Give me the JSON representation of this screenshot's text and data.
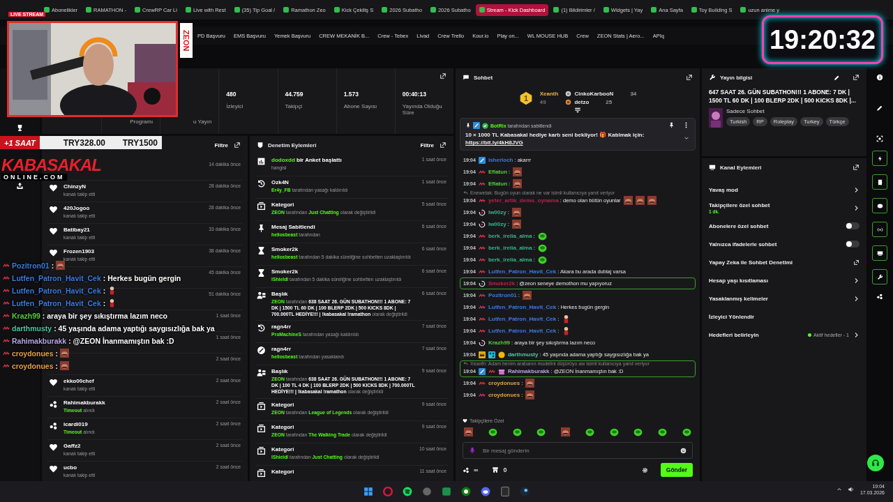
{
  "browser": {
    "tabs": [
      {
        "label": "Abonelikler",
        "selected": false
      },
      {
        "label": "RAMATHON -",
        "selected": false
      },
      {
        "label": "CrewRP Car Li",
        "selected": false
      },
      {
        "label": "Live with Rest",
        "selected": false
      },
      {
        "label": "(35) Tip Goal /",
        "selected": false
      },
      {
        "label": "Ramathon Zeo",
        "selected": false
      },
      {
        "label": "Kick Çekiliş S",
        "selected": false
      },
      {
        "label": "2026 Subatho",
        "selected": false
      },
      {
        "label": "2026 Subatho",
        "selected": false
      },
      {
        "label": "Stream - Kick Dashboard",
        "selected": true
      },
      {
        "label": "(1) Bildirimler /",
        "selected": false
      },
      {
        "label": "Widgets | Yay",
        "selected": false
      },
      {
        "label": "Ana Sayfa",
        "selected": false
      },
      {
        "label": "Toy Building S",
        "selected": false
      },
      {
        "label": "uzun anime y",
        "selected": false
      }
    ],
    "bookmarks": [
      "PD Başvuru",
      "EMS Başvuru",
      "Yemek Başvuru",
      "CREW MEKANİK B...",
      "Crew - Tebex",
      "Livad",
      "Crew Trello",
      "Kour.io",
      "Play on...",
      "WL MOUSE HUB",
      "Crew",
      "ZEON Stats | Aero...",
      "APIq"
    ]
  },
  "overlay": {
    "live_badge": "LIVE STREAM",
    "brand": "ZEON",
    "timer": "19:20:32",
    "goal": {
      "tag": "+1 SAAT",
      "current": "TRY328.00",
      "target": "TRY1500"
    },
    "logo": {
      "title": "KABASAKAL",
      "subtitle": "ONLINE.COM"
    },
    "chat": [
      {
        "user": "Pozitron01",
        "color": "#3d7be0",
        "text": ":",
        "emotes": [
          {
            "kind": "face"
          }
        ]
      },
      {
        "user": "Lutfen_Patron_Havit_Cek",
        "color": "#3d7be0",
        "text": ": Herkes bugün gergin"
      },
      {
        "user": "Lutfen_Patron_Havit_Cek",
        "color": "#3d7be0",
        "text": ":",
        "emotes": [
          {
            "kind": "figure"
          }
        ]
      },
      {
        "user": "Lutfen_Patron_Havit_Cek",
        "color": "#3d7be0",
        "text": ":",
        "emotes": [
          {
            "kind": "figure"
          }
        ]
      },
      {
        "user": "Krazh99",
        "color": "#53d03a",
        "text": ": araya bir şey sıkıştırma lazım neco"
      },
      {
        "user": "darthmusty",
        "color": "#4fc7a0",
        "text": ": 45 yaşında adama yaptığı saygısızlığa bak ya"
      },
      {
        "user": "Rahimakburakk",
        "color": "#b9a6e8",
        "text": ": @ZEON İnanmamıştın bak :D"
      },
      {
        "user": "croydonues",
        "color": "#e8a24a",
        "text": ":",
        "emotes": [
          {
            "kind": "face"
          }
        ]
      },
      {
        "user": "croydonues",
        "color": "#e8a24a",
        "text": ":",
        "emotes": [
          {
            "kind": "face"
          }
        ]
      }
    ]
  },
  "stats": {
    "items": [
      {
        "label": "Programı"
      },
      {
        "label": "u Yayın"
      },
      {
        "value": "480",
        "label": "İzleyici"
      },
      {
        "value": "44.759",
        "label": "Takipçi"
      },
      {
        "value": "1.573",
        "label": "Abone Sayısı"
      },
      {
        "value": "00:40:13",
        "label": "Yayında Olduğu Süre"
      }
    ]
  },
  "activity": {
    "filter": "Filtre",
    "items": [
      {
        "kind": "hidden",
        "time": "14 dakika önce"
      },
      {
        "kind": "follow",
        "name": "ChinzyN",
        "action": [
          {
            "kind": "plain",
            "text": "kanalı takip etti"
          }
        ],
        "time": "28 dakika önce"
      },
      {
        "kind": "follow",
        "name": "420Jogoo",
        "action": [
          {
            "kind": "plain",
            "text": "kanalı takip etti"
          }
        ],
        "time": "28 dakika önce"
      },
      {
        "kind": "follow",
        "name": "Batibay21",
        "action": [
          {
            "kind": "plain",
            "text": "kanalı takip etti"
          }
        ],
        "time": "33 dakika önce"
      },
      {
        "kind": "follow",
        "name": "Frozen1903",
        "action": [
          {
            "kind": "plain",
            "text": "kanalı takip etti"
          }
        ],
        "time": "38 dakika önce"
      },
      {
        "kind": "hidden",
        "time": "45 dakika önce"
      },
      {
        "kind": "hidden",
        "time": "51 dakika önce"
      },
      {
        "kind": "hidden",
        "time": "1 saat önce"
      },
      {
        "kind": "hidden",
        "time": "1 saat önce"
      },
      {
        "kind": "hidden",
        "time": "2 saat önce"
      },
      {
        "kind": "follow",
        "name": "ekko00chef",
        "action": [
          {
            "kind": "plain",
            "text": "kanalı takip etti"
          }
        ],
        "time": "2 saat önce"
      },
      {
        "kind": "timeout",
        "name": "Rahimakburakk",
        "action": [
          {
            "kind": "user",
            "text": "Timeout"
          },
          {
            "kind": "plain",
            "text": " alındı"
          }
        ],
        "time": "2 saat önce"
      },
      {
        "kind": "timeout",
        "name": "icardi019",
        "action": [
          {
            "kind": "user",
            "text": "Timeout"
          },
          {
            "kind": "plain",
            "text": " alındı"
          }
        ],
        "time": "2 saat önce"
      },
      {
        "kind": "follow",
        "name": "Gaffz2",
        "action": [
          {
            "kind": "plain",
            "text": "kanalı takip etti"
          }
        ],
        "time": "2 saat önce"
      },
      {
        "kind": "follow",
        "name": "ucbo",
        "action": [
          {
            "kind": "plain",
            "text": "kanalı takip etti"
          }
        ],
        "time": "2 saat önce"
      }
    ]
  },
  "moderation": {
    "title": "Denetim Eylemleri",
    "filter": "Filtre",
    "items": [
      {
        "kind": "poll",
        "title": [
          {
            "kind": "user",
            "text": "dodoxdd"
          },
          {
            "kind": "strong",
            "text": " bir Anket başlattı"
          }
        ],
        "detail": [
          {
            "kind": "plain",
            "text": "hangisi"
          }
        ],
        "time": "1 saat önce"
      },
      {
        "kind": "unban",
        "title": [
          {
            "kind": "strong",
            "text": "Ozk4N"
          }
        ],
        "detail": [
          {
            "kind": "user",
            "text": "Er4y_FB"
          },
          {
            "kind": "plain",
            "text": " tarafından yasağı kaldırıldı"
          }
        ],
        "time": "1 saat önce"
      },
      {
        "kind": "category",
        "title": [
          {
            "kind": "strong",
            "text": "Kategori"
          }
        ],
        "detail": [
          {
            "kind": "user",
            "text": "ZEON"
          },
          {
            "kind": "plain",
            "text": " tarafından "
          },
          {
            "kind": "user",
            "text": "Just Chatting"
          },
          {
            "kind": "plain",
            "text": " olarak değiştirildi"
          }
        ],
        "time": "5 saat önce"
      },
      {
        "kind": "pin",
        "title": [
          {
            "kind": "strong",
            "text": "Mesaj Sabitlendi"
          }
        ],
        "detail": [
          {
            "kind": "user",
            "text": "heliosbeast"
          },
          {
            "kind": "plain",
            "text": " tarafından"
          }
        ],
        "time": "6 saat önce"
      },
      {
        "kind": "timeout",
        "title": [
          {
            "kind": "strong",
            "text": "Smoker2k"
          }
        ],
        "detail": [
          {
            "kind": "user",
            "text": "heliosbeast"
          },
          {
            "kind": "plain",
            "text": " tarafından 5 dakika süreliğine sohbetten uzaklaştırıldı"
          }
        ],
        "time": "6 saat önce"
      },
      {
        "kind": "timeout",
        "title": [
          {
            "kind": "strong",
            "text": "Smoker2k"
          }
        ],
        "detail": [
          {
            "kind": "user",
            "text": "lShieldl"
          },
          {
            "kind": "plain",
            "text": " tarafından 5 dakika süreliğine sohbetten uzaklaştırıldı"
          }
        ],
        "time": "6 saat önce"
      },
      {
        "kind": "title",
        "title": [
          {
            "kind": "strong",
            "text": "Başlık"
          }
        ],
        "detail": [
          {
            "kind": "user",
            "text": "ZEON"
          },
          {
            "kind": "plain",
            "text": " tarafından "
          },
          {
            "kind": "strong",
            "text": "638 SAAT 26. GÜN SUBATHON!!! 1 ABONE: 7 DK | 1500 TL 60 DK | 100 BLERP 2DK | 500 KICKS 8DK | 700.000TL HEDİYE!!! | !kabasakal !ramathon"
          },
          {
            "kind": "plain",
            "text": " olarak değiştirildi"
          }
        ],
        "time": "6 saat önce"
      },
      {
        "kind": "unban",
        "title": [
          {
            "kind": "strong",
            "text": "ragn4rr"
          }
        ],
        "detail": [
          {
            "kind": "user",
            "text": "ProMachineS"
          },
          {
            "kind": "plain",
            "text": " tarafından yasağı kaldırıldı"
          }
        ],
        "time": "7 saat önce"
      },
      {
        "kind": "ban",
        "title": [
          {
            "kind": "strong",
            "text": "ragn4rr"
          }
        ],
        "detail": [
          {
            "kind": "user",
            "text": "heliosbeast"
          },
          {
            "kind": "plain",
            "text": " tarafından yasaklandı"
          }
        ],
        "time": "7 saat önce"
      },
      {
        "kind": "title",
        "title": [
          {
            "kind": "strong",
            "text": "Başlık"
          }
        ],
        "detail": [
          {
            "kind": "user",
            "text": "ZEON"
          },
          {
            "kind": "plain",
            "text": " tarafından "
          },
          {
            "kind": "strong",
            "text": "638 SAAT 26. GÜN SUBATHON!!! 1 ABONE: 7 DK | 100 TL 4 DK | 100 BLERP 2DK | 500 KICKS 8DK | 700.000TL HEDİYE!!! | !kabasakal !ramathon"
          },
          {
            "kind": "plain",
            "text": " olarak değiştirildi"
          }
        ],
        "time": "9 saat önce"
      },
      {
        "kind": "category",
        "title": [
          {
            "kind": "strong",
            "text": "Kategori"
          }
        ],
        "detail": [
          {
            "kind": "user",
            "text": "ZEON"
          },
          {
            "kind": "plain",
            "text": " tarafından "
          },
          {
            "kind": "user",
            "text": "League of Legends"
          },
          {
            "kind": "plain",
            "text": " olarak değiştirildi"
          }
        ],
        "time": "9 saat önce"
      },
      {
        "kind": "category",
        "title": [
          {
            "kind": "strong",
            "text": "Kategori"
          }
        ],
        "detail": [
          {
            "kind": "user",
            "text": "ZEON"
          },
          {
            "kind": "plain",
            "text": " tarafından "
          },
          {
            "kind": "user",
            "text": "The Walking Trade"
          },
          {
            "kind": "plain",
            "text": " olarak değiştirildi"
          }
        ],
        "time": "9 saat önce"
      },
      {
        "kind": "category",
        "title": [
          {
            "kind": "strong",
            "text": "Kategori"
          }
        ],
        "detail": [
          {
            "kind": "user",
            "text": "lShieldl"
          },
          {
            "kind": "plain",
            "text": " tarafından "
          },
          {
            "kind": "user",
            "text": "Just Chatting"
          },
          {
            "kind": "plain",
            "text": " olarak değiştirildi"
          }
        ],
        "time": "10 saat önce"
      },
      {
        "kind": "category",
        "title": [
          {
            "kind": "strong",
            "text": "Kategori"
          }
        ],
        "time": "11 saat önce"
      }
    ]
  },
  "chat": {
    "title": "Sohbet",
    "gifters": [
      {
        "name": "Xeanth",
        "count": "49",
        "kind": "gold",
        "rank": "1"
      },
      {
        "name": "CinkoKarbooN",
        "count": "34",
        "kind": "silver"
      },
      {
        "name": "detzo",
        "count": "25",
        "kind": "bronze"
      }
    ],
    "pinned": {
      "author": "BotRix",
      "note": "tarafından sabitlendi",
      "text": "10 × 1000 TL Kabasakal hediye kartı seni bekliyor! 🎁 Katılmak için:",
      "link": "https://bit.ly/4kH8JVG"
    },
    "messages": [
      {
        "time": "19:04",
        "badges": [
          {
            "kind": "mod"
          }
        ],
        "user": "Isherloch",
        "color": "#3d7be0",
        "text": ": akarrr",
        "highlighted": false
      },
      {
        "time": "19:04",
        "badges": [
          {
            "kind": "sub"
          }
        ],
        "user": "Eflatun",
        "color": "#53d03a",
        "text": ":",
        "emotes": [
          {
            "kind": "face"
          }
        ],
        "highlighted": false
      },
      {
        "time": "19:04",
        "badges": [
          {
            "kind": "sub"
          }
        ],
        "user": "Eflatun",
        "color": "#53d03a",
        "text": ":",
        "emotes": [
          {
            "kind": "face"
          }
        ],
        "highlighted": false
      },
      {
        "time": "19:04",
        "badges": [
          {
            "kind": "sub"
          }
        ],
        "user": "yeter_artik_demo_oynama",
        "color": "#c21f4a",
        "text": ": demo olan bütün oyunlar",
        "emotes": [
          {
            "kind": "face"
          },
          {
            "kind": "face"
          },
          {
            "kind": "face"
          }
        ],
        "reply": "Enewetak: Bugün oyun olarak ne var isimli kullanıcıya yanıt veriyor",
        "highlighted": false
      },
      {
        "time": "19:04",
        "badges": [
          {
            "kind": "ring"
          }
        ],
        "user": "lw00zy",
        "color": "#2fb889",
        "text": ":",
        "emotes": [
          {
            "kind": "face"
          }
        ],
        "highlighted": false
      },
      {
        "time": "19:04",
        "badges": [
          {
            "kind": "ring"
          }
        ],
        "user": "lw00zy",
        "color": "#2fb889",
        "text": ":",
        "emotes": [
          {
            "kind": "face"
          }
        ],
        "highlighted": false
      },
      {
        "time": "19:04",
        "badges": [
          {
            "kind": "sub"
          }
        ],
        "user": "berk_irelia_alma",
        "color": "#2fb889",
        "text": ":",
        "emotes": [
          {
            "kind": "pepe"
          }
        ],
        "highlighted": false
      },
      {
        "time": "19:04",
        "badges": [
          {
            "kind": "sub"
          }
        ],
        "user": "berk_irelia_alma",
        "color": "#2fb889",
        "text": ":",
        "emotes": [
          {
            "kind": "pepe"
          }
        ],
        "highlighted": false
      },
      {
        "time": "19:04",
        "badges": [
          {
            "kind": "sub"
          }
        ],
        "user": "berk_irelia_alma",
        "color": "#2fb889",
        "text": ":",
        "emotes": [
          {
            "kind": "pepe"
          }
        ],
        "highlighted": false
      },
      {
        "time": "19:04",
        "badges": [
          {
            "kind": "sub"
          }
        ],
        "user": "Lutfen_Patron_Havit_Cek",
        "color": "#3d7be0",
        "text": ": Akara bu arada dublaj varsa",
        "highlighted": false
      },
      {
        "time": "19:04",
        "badges": [
          {
            "kind": "ring"
          }
        ],
        "user": "Smoker2k",
        "color": "#c21f4a",
        "text": ": @zeon seneye demothon mu yapıyoruz",
        "highlighted": true
      },
      {
        "time": "19:04",
        "badges": [
          {
            "kind": "sub"
          }
        ],
        "user": "Pozitron01",
        "color": "#3d7be0",
        "text": ":",
        "emotes": [
          {
            "kind": "face"
          }
        ],
        "highlighted": false
      },
      {
        "time": "19:04",
        "badges": [
          {
            "kind": "sub"
          }
        ],
        "user": "Lutfen_Patron_Havit_Cek",
        "color": "#3d7be0",
        "text": ": Herkes bugün gergin",
        "highlighted": false
      },
      {
        "time": "19:04",
        "badges": [
          {
            "kind": "sub"
          }
        ],
        "user": "Lutfen_Patron_Havit_Cek",
        "color": "#3d7be0",
        "text": ":",
        "emotes": [
          {
            "kind": "figure"
          }
        ],
        "highlighted": false
      },
      {
        "time": "19:04",
        "badges": [
          {
            "kind": "sub"
          }
        ],
        "user": "Lutfen_Patron_Havit_Cek",
        "color": "#3d7be0",
        "text": ":",
        "emotes": [
          {
            "kind": "figure"
          }
        ],
        "highlighted": false
      },
      {
        "time": "19:04",
        "badges": [
          {
            "kind": "ring"
          }
        ],
        "user": "Krazh99",
        "color": "#53d03a",
        "text": ": araya bir şey sıkıştırma lazım neco",
        "highlighted": false
      },
      {
        "time": "19:04",
        "badges": [
          {
            "kind": "crown"
          },
          {
            "kind": "grid"
          },
          {
            "kind": "coin"
          }
        ],
        "user": "darthmusty",
        "color": "#4fc7a0",
        "text": ": 45 yaşında adama yaptığı saygısızlığa bak ya",
        "highlighted": false
      },
      {
        "time": "19:04",
        "badges": [
          {
            "kind": "mod"
          },
          {
            "kind": "sub"
          },
          {
            "kind": "gift"
          }
        ],
        "user": "Rahimakburakk",
        "color": "#b9a6e8",
        "text": ": @ZEON İnanmamıştın bak :D",
        "reply": "Xeanth: Adam benim arabanın modelini düşürüyo aw isimli kullanıcıya yanıt veriyor",
        "highlighted": true
      },
      {
        "time": "19:04",
        "badges": [
          {
            "kind": "sub"
          }
        ],
        "user": "croydonues",
        "color": "#e8a24a",
        "text": ":",
        "emotes": [
          {
            "kind": "face"
          }
        ],
        "highlighted": false
      },
      {
        "time": "19:04",
        "badges": [
          {
            "kind": "sub"
          }
        ],
        "user": "croydonues",
        "color": "#e8a24a",
        "text": ":",
        "emotes": [
          {
            "kind": "face"
          }
        ],
        "highlighted": false
      }
    ],
    "emote_label": "Takipçilere Özel",
    "emote_bar": [
      {
        "kind": "face"
      },
      {
        "kind": "pepe"
      },
      {
        "kind": "pepe"
      },
      {
        "kind": "pepe"
      },
      {
        "kind": "face"
      },
      {
        "kind": "pepe"
      },
      {
        "kind": "pepe"
      },
      {
        "kind": "pepe"
      },
      {
        "kind": "pepe"
      },
      {
        "kind": "pepe"
      }
    ],
    "input": {
      "placeholder": "Bir mesaj gönderin"
    },
    "points": "∞",
    "store_count": "0",
    "send": "Gönder"
  },
  "stream_info": {
    "title": "Yayın bilgisi",
    "stream_title": "647 SAAT 26. GÜN SUBATHON!!! 1 ABONE: 7 DK | 1500 TL 60 DK | 100 BLERP 2DK | 500 KICKS 8DK |...",
    "category": "Sadece Sohbet",
    "tags": [
      "Turkish",
      "RP",
      "Roleplay",
      "Turkey",
      "Türkçe"
    ]
  },
  "channel_actions": {
    "title": "Kanal Eylemleri",
    "items": [
      {
        "kind": "link",
        "label": "Yavaş mod"
      },
      {
        "kind": "link",
        "label": "Takipçilere özel sohbet",
        "sub": "1 dk."
      },
      {
        "kind": "toggle",
        "label": "Abonelere özel sohbet",
        "on": false
      },
      {
        "kind": "toggle",
        "label": "Yalnızca ifadelerle sohbet",
        "on": false
      },
      {
        "kind": "external",
        "label": "Yapay Zeka ile Sohbet Denetimi"
      },
      {
        "kind": "link",
        "label": "Hesap yaşı kısıtlaması"
      },
      {
        "kind": "link",
        "label": "Yasaklanmış kelimeler"
      },
      {
        "kind": "plain",
        "label": "İzleyici Yönlendir"
      },
      {
        "kind": "link",
        "label": "Hedefleri belirleyin",
        "status": "Aktif hedefler - 1"
      }
    ]
  },
  "taskbar": {
    "time": "19:04",
    "date": "17.03.2026"
  }
}
